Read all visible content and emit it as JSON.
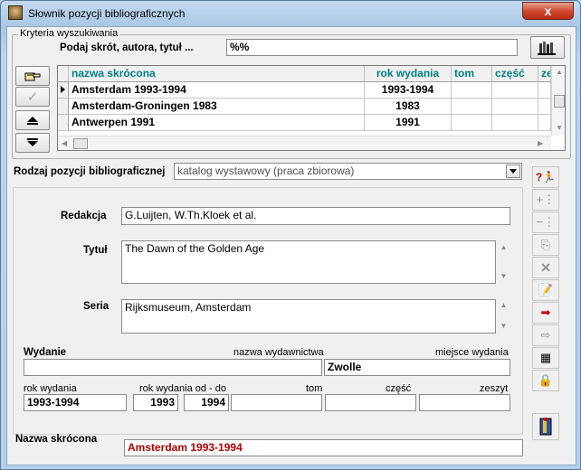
{
  "window": {
    "title": "Słownik pozycji bibliograficznych",
    "close_label": "x"
  },
  "search": {
    "group_label": "Kryteria wyszukiwania",
    "prompt": "Podaj skrót, autora, tytuł ...",
    "value": "%%"
  },
  "grid": {
    "columns": [
      "nazwa skrócona",
      "rok wydania",
      "tom",
      "część",
      "ze"
    ],
    "rows": [
      {
        "name": "Amsterdam 1993-1994",
        "year": "1993-1994",
        "tom": "",
        "czesc": ""
      },
      {
        "name": "Amsterdam-Groningen 1983",
        "year": "1983",
        "tom": "",
        "czesc": ""
      },
      {
        "name": "Antwerpen 1991",
        "year": "1991",
        "tom": "",
        "czesc": ""
      }
    ]
  },
  "type": {
    "label": "Rodzaj pozycji bibliograficznej",
    "value": "katalog wystawowy (praca zbiorowa)"
  },
  "form": {
    "redakcja_label": "Redakcja",
    "redakcja_value": "G.Luijten, W.Th.Kloek et al.",
    "tytul_label": "Tytuł",
    "tytul_value": "The Dawn of the Golden Age",
    "seria_label": "Seria",
    "seria_value": "Rijksmuseum, Amsterdam",
    "wydanie_label": "Wydanie",
    "wydawnictwo_label": "nazwa wydawnictwa",
    "miejsce_label": "miejsce wydania",
    "wydanie_value": "",
    "miejsce_value": "Zwolle",
    "rok_label": "rok wydania",
    "rok_od_do_label": "rok wydania od - do",
    "tom_label": "tom",
    "czesc_label": "część",
    "zeszyt_label": "zeszyt",
    "rok_value": "1993-1994",
    "rok_od_value": "1993",
    "rok_do_value": "1994",
    "tom_value": "",
    "czesc_value": "",
    "zeszyt_value": "",
    "nazwa_label": "Nazwa skrócona",
    "nazwa_value": "Amsterdam 1993-1994"
  },
  "colors": {
    "header_text": "#008080",
    "name_value": "#b00000"
  }
}
